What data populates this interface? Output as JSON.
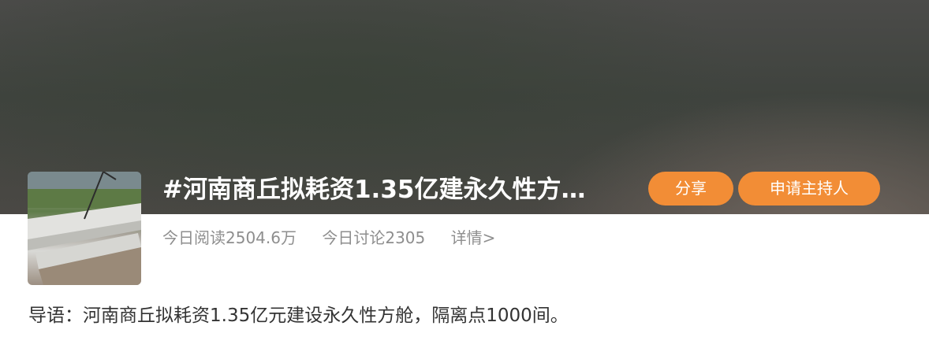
{
  "topic": {
    "title": "#河南商丘拟耗资1.35亿建永久性方…",
    "thumbnail": "construction-site-photo"
  },
  "actions": {
    "share_label": "分享",
    "apply_host_label": "申请主持人"
  },
  "stats": {
    "today_reads": "今日阅读2504.6万",
    "today_discussions": "今日讨论2305",
    "details_label": "详情>"
  },
  "intro": {
    "text": "导语：河南商丘拟耗资1.35亿元建设永久性方舱，隔离点1000间。"
  },
  "colors": {
    "accent": "#f28d36",
    "secondary_text": "#8e8e8e",
    "body_text": "#333333"
  }
}
